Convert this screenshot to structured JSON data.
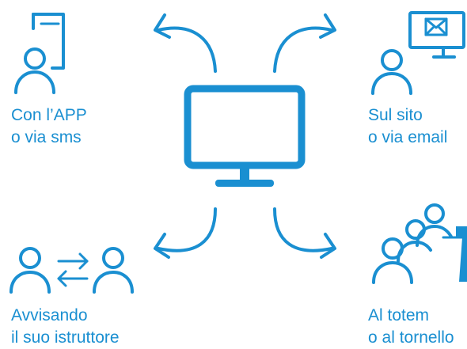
{
  "colors": {
    "accent": "#1a8fd1"
  },
  "center": {
    "icon": "monitor-icon"
  },
  "methods": [
    {
      "id": "app-sms",
      "icon": "person-phone-icon",
      "line1": "Con l’APP",
      "line2": "o via sms"
    },
    {
      "id": "web-email",
      "icon": "person-computer-email-icon",
      "line1": "Sul sito",
      "line2": "o via email"
    },
    {
      "id": "instructor",
      "icon": "people-exchange-icon",
      "line1": "Avvisando",
      "line2": "il suo istruttore"
    },
    {
      "id": "totem",
      "icon": "people-turnstile-icon",
      "line1": "Al totem",
      "line2": "o al tornello"
    }
  ]
}
